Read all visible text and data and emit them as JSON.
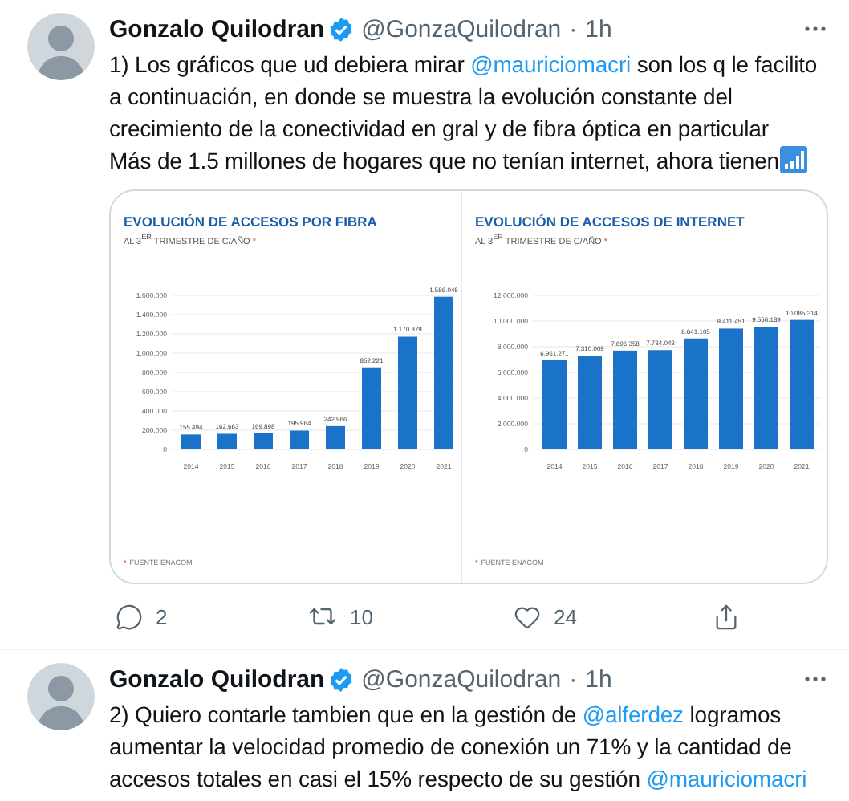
{
  "tweets": [
    {
      "author": "Gonzalo Quilodran",
      "verified": true,
      "handle": "@GonzaQuilodran",
      "separator": "·",
      "time": "1h",
      "paragraphs": [
        [
          {
            "kind": "text",
            "text": "1) Los gráficos que ud debiera mirar "
          },
          {
            "kind": "mention",
            "text": "@mauriciomacri"
          },
          {
            "kind": "text",
            "text": " son los q le facilito  a continuación, en donde se muestra la evolución constante del crecimiento de la conectividad en gral y de fibra óptica en particular"
          }
        ],
        [
          {
            "kind": "text",
            "text": "Más de 1.5 millones de hogares que no tenían internet, ahora tienen"
          },
          {
            "kind": "signal"
          }
        ]
      ],
      "charts": [
        {
          "chart_data": {
            "type": "bar",
            "title": "EVOLUCIÓN DE ACCESOS POR FIBRA",
            "categories": [
              "2014",
              "2015",
              "2016",
              "2017",
              "2018",
              "2019",
              "2020",
              "2021"
            ],
            "values": [
              155494,
              162663,
              169898,
              195964,
              242966,
              852221,
              1170879,
              1586048
            ],
            "ylim": [
              0,
              1600000
            ],
            "yticks": [
              {
                "value": 0,
                "label": "0"
              },
              {
                "value": 200000,
                "label": "200.000"
              },
              {
                "value": 400000,
                "label": "400.000"
              },
              {
                "value": 600000,
                "label": "600.000"
              },
              {
                "value": 800000,
                "label": "800.000"
              },
              {
                "value": 1000000,
                "label": "1.000.000"
              },
              {
                "value": 1200000,
                "label": "1.200.000"
              },
              {
                "value": 1400000,
                "label": "1.400.000"
              },
              {
                "value": 1600000,
                "label": "1.600.000"
              }
            ],
            "data_labels": true,
            "grid": true,
            "value_labels": [
              "155.494",
              "162.663",
              "169.898",
              "195.964",
              "242.966",
              "852.221",
              "1.170.879",
              "1.586.048"
            ]
          },
          "subtitle": "AL 3$^{ER}$ TRIMESTRE DE C/AÑO",
          "mark": "*",
          "source": "FUENTE ENACOM"
        },
        {
          "chart_data": {
            "type": "bar",
            "title": "EVOLUCIÓN DE ACCESOS DE INTERNET",
            "categories": [
              "2014",
              "2015",
              "2016",
              "2017",
              "2018",
              "2019",
              "2020",
              "2021"
            ],
            "values": [
              6961271,
              7310009,
              7696358,
              7734043,
              8641105,
              9411451,
              9556189,
              10085314
            ],
            "ylim": [
              0,
              12000000
            ],
            "yticks": [
              {
                "value": 0,
                "label": "0"
              },
              {
                "value": 2000000,
                "label": "2.000.000"
              },
              {
                "value": 4000000,
                "label": "4.000.000"
              },
              {
                "value": 6000000,
                "label": "6.000.000"
              },
              {
                "value": 8000000,
                "label": "8.000.000"
              },
              {
                "value": 10000000,
                "label": "10.000.000"
              },
              {
                "value": 12000000,
                "label": "12.000.000"
              }
            ],
            "data_labels": true,
            "grid": true,
            "value_labels": [
              "6.961.271",
              "7.310.009",
              "7.696.358",
              "7.734.043",
              "8.641.105",
              "9.411.451",
              "9.556.189",
              "10.085.314"
            ]
          },
          "subtitle": "AL 3$^{ER}$ TRIMESTRE DE C/AÑO",
          "mark": "*",
          "source": "FUENTE ENACOM"
        }
      ],
      "actions": [
        {
          "kind": "reply",
          "count": "2"
        },
        {
          "kind": "retweet",
          "count": "10"
        },
        {
          "kind": "like",
          "count": "24"
        },
        {
          "kind": "share"
        }
      ]
    },
    {
      "author": "Gonzalo Quilodran",
      "verified": true,
      "handle": "@GonzaQuilodran",
      "separator": "·",
      "time": "1h",
      "paragraphs": [
        [
          {
            "kind": "text",
            "text": "2) Quiero contarle tambien que en la gestión de "
          },
          {
            "kind": "mention",
            "text": "@alferdez"
          },
          {
            "kind": "text",
            "text": " logramos aumentar la velocidad promedio de conexión un 71% y la cantidad de accesos totales en casi el 15% respecto de su gestión "
          },
          {
            "kind": "mention",
            "text": "@mauriciomacri"
          }
        ]
      ]
    }
  ]
}
